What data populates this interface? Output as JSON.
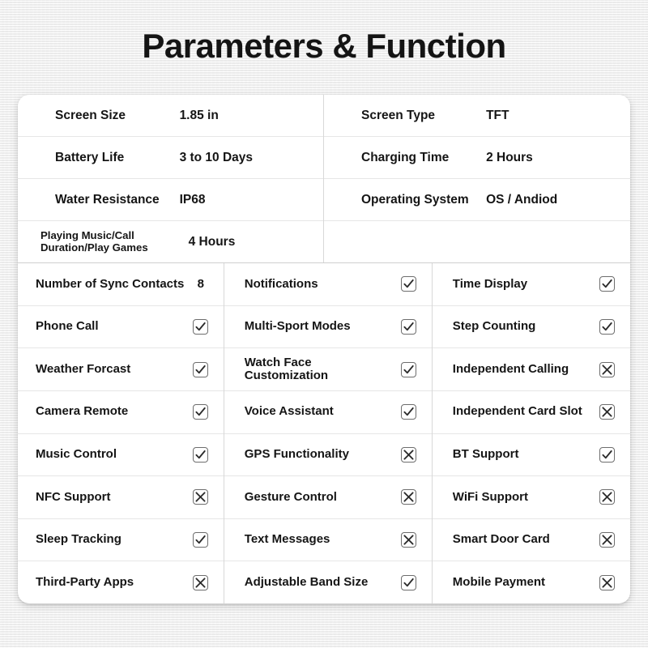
{
  "page": {
    "title": "Parameters & Function"
  },
  "specs": {
    "left": [
      {
        "label": "Screen Size",
        "value": "1.85 in",
        "small": false
      },
      {
        "label": "Battery Life",
        "value": "3 to 10 Days",
        "small": false
      },
      {
        "label": "Water Resistance",
        "value": "IP68",
        "small": false
      },
      {
        "label": "Playing Music/Call Duration/Play Games",
        "value": "4 Hours",
        "small": true
      }
    ],
    "right": [
      {
        "label": "Screen Type",
        "value": "TFT",
        "small": false
      },
      {
        "label": "Charging Time",
        "value": "2 Hours",
        "small": false
      },
      {
        "label": "Operating System",
        "value": "OS / Andiod",
        "small": false
      },
      {
        "label": "",
        "value": "",
        "small": false
      }
    ]
  },
  "features": {
    "column1": [
      {
        "label": "Number of Sync Contacts",
        "mark": "8",
        "type": "text"
      },
      {
        "label": "Phone Call",
        "mark": "check",
        "type": "box"
      },
      {
        "label": "Weather Forcast",
        "mark": "check",
        "type": "box"
      },
      {
        "label": "Camera Remote",
        "mark": "check",
        "type": "box"
      },
      {
        "label": "Music Control",
        "mark": "check",
        "type": "box"
      },
      {
        "label": "NFC Support",
        "mark": "cross",
        "type": "box"
      },
      {
        "label": "Sleep Tracking",
        "mark": "check",
        "type": "box"
      },
      {
        "label": "Third-Party Apps",
        "mark": "cross",
        "type": "box"
      }
    ],
    "column2": [
      {
        "label": "Notifications",
        "mark": "check",
        "type": "box"
      },
      {
        "label": "Multi-Sport Modes",
        "mark": "check",
        "type": "box"
      },
      {
        "label": "Watch Face Customization",
        "mark": "check",
        "type": "box"
      },
      {
        "label": "Voice Assistant",
        "mark": "check",
        "type": "box"
      },
      {
        "label": "GPS Functionality",
        "mark": "cross",
        "type": "box"
      },
      {
        "label": "Gesture Control",
        "mark": "cross",
        "type": "box"
      },
      {
        "label": "Text Messages",
        "mark": "cross",
        "type": "box"
      },
      {
        "label": "Adjustable Band Size",
        "mark": "check",
        "type": "box"
      }
    ],
    "column3": [
      {
        "label": "Time Display",
        "mark": "check",
        "type": "box"
      },
      {
        "label": "Step Counting",
        "mark": "check",
        "type": "box"
      },
      {
        "label": "Independent Calling",
        "mark": "cross",
        "type": "box"
      },
      {
        "label": "Independent Card Slot",
        "mark": "cross",
        "type": "box"
      },
      {
        "label": "BT Support",
        "mark": "check",
        "type": "box"
      },
      {
        "label": "WiFi Support",
        "mark": "cross",
        "type": "box"
      },
      {
        "label": "Smart Door Card",
        "mark": "cross",
        "type": "box"
      },
      {
        "label": "Mobile Payment",
        "mark": "cross",
        "type": "box"
      }
    ]
  },
  "colors": {
    "text": "#151515",
    "card_background": "#ffffff",
    "page_background": "#f2f2f2",
    "box_border": "#6d6d6d",
    "divider": "#e6e6e6"
  }
}
